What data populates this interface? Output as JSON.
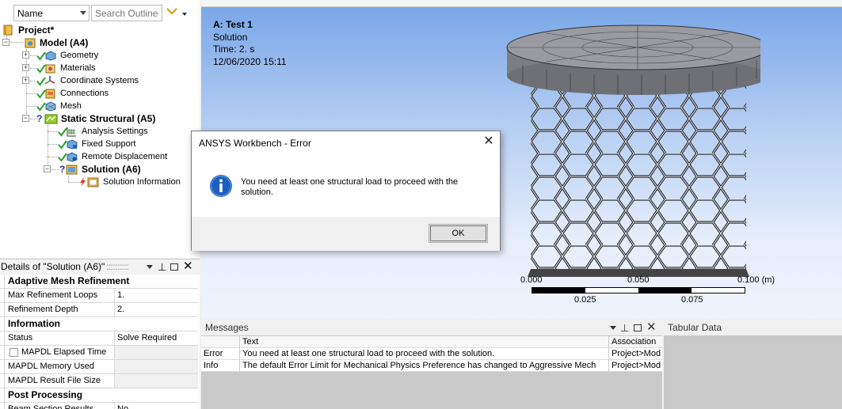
{
  "outline": {
    "name_filter": "Name",
    "search_placeholder": "Search Outline",
    "tree": [
      {
        "label": "Project*",
        "bold": true
      },
      {
        "label": "Model (A4)",
        "bold": true
      },
      {
        "label": "Geometry"
      },
      {
        "label": "Materials"
      },
      {
        "label": "Coordinate Systems"
      },
      {
        "label": "Connections"
      },
      {
        "label": "Mesh"
      },
      {
        "label": "Static Structural (A5)",
        "bold": true
      },
      {
        "label": "Analysis Settings"
      },
      {
        "label": "Fixed Support"
      },
      {
        "label": "Remote Displacement"
      },
      {
        "label": "Solution (A6)",
        "bold": true
      },
      {
        "label": "Solution Information"
      }
    ]
  },
  "details": {
    "title": "Details of \"Solution (A6)\"",
    "rows": [
      {
        "key": "Adaptive Mesh Refinement",
        "group": true
      },
      {
        "key": "Max Refinement Loops",
        "value": "1."
      },
      {
        "key": "Refinement Depth",
        "value": "2."
      },
      {
        "key": "Information",
        "group": true
      },
      {
        "key": "Status",
        "value": "Solve Required"
      },
      {
        "key": "MAPDL Elapsed Time",
        "value": "",
        "gray": true,
        "checkbox": true
      },
      {
        "key": "MAPDL Memory Used",
        "value": "",
        "gray": true
      },
      {
        "key": "MAPDL Result File Size",
        "value": "",
        "gray": true
      },
      {
        "key": "Post Processing",
        "group": true
      },
      {
        "key": "Beam Section Results",
        "value": "No"
      }
    ]
  },
  "graphics": {
    "analysis_title": "A: Test 1",
    "result_type": "Solution",
    "time": "Time: 2. s",
    "date": "12/06/2020 15:11",
    "scale": {
      "labels_top": [
        "0.000",
        "0.050",
        "0.100 (m)"
      ],
      "labels_bottom": [
        "0.025",
        "0.075"
      ]
    }
  },
  "dialog": {
    "title": "ANSYS Workbench - Error",
    "message": "You need at least one structural load to proceed with the solution.",
    "ok_label": "OK",
    "icon": "info-icon"
  },
  "messages": {
    "title": "Messages",
    "columns": [
      "",
      "Text",
      "Association"
    ],
    "rows": [
      {
        "type": "Error",
        "text": "You need at least one structural load to proceed with the solution.",
        "assoc": "Project>Mod"
      },
      {
        "type": "Info",
        "text": "The default Error Limit for Mechanical Physics Preference has changed to Aggressive Mech",
        "assoc": "Project>Mod"
      }
    ]
  },
  "tabular": {
    "title": "Tabular Data"
  },
  "colors": {
    "accent_check": "#2aa02a",
    "error_bolt": "#e03020",
    "question": "#1d3fa8",
    "dialog_info": "#1e5fbf"
  }
}
